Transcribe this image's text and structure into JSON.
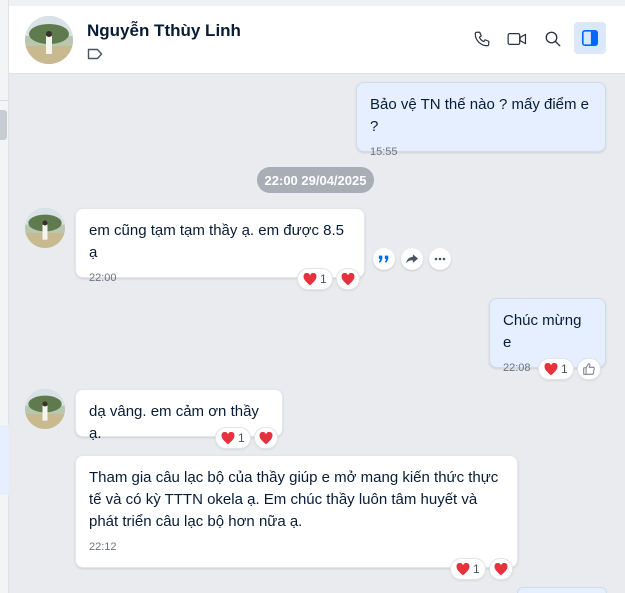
{
  "contact": {
    "name": "Nguyễn Tthùy Linh"
  },
  "header_icons": [
    "phone-icon",
    "video-call-icon",
    "search-icon",
    "sidebar-toggle-icon"
  ],
  "colors": {
    "my_bubble": "#e5efff",
    "their_bubble": "#ffffff",
    "heart": "#e5323e",
    "background": "#e9ebee",
    "time_badge": "#a8adb6"
  },
  "messages": {
    "m1": {
      "text": "Bảo vệ TN thế nào ? mấy điểm e ?",
      "time": "15:55"
    },
    "date_badge": "22:00 29/04/2025",
    "m2": {
      "text": "em cũng tạm tạm thầy ạ. em được 8.5 ạ",
      "time": "22:00",
      "reaction_count": "1"
    },
    "m3": {
      "text": "Chúc mừng e",
      "time": "22:08",
      "reaction_count": "1"
    },
    "m4": {
      "text": "dạ vâng. em cảm ơn thầy ạ.",
      "reaction_count": "1"
    },
    "m5": {
      "text": "Tham gia câu lạc bộ của thầy giúp e mở mang kiến thức thực tế và có kỳ TTTN okela ạ. Em chúc thầy luôn tâm huyết và phát triển câu lạc bộ hơn nữa ạ.",
      "time": "22:12",
      "reaction_count": "1"
    }
  },
  "message_actions": [
    "quote-icon",
    "share-icon",
    "more-icon"
  ]
}
